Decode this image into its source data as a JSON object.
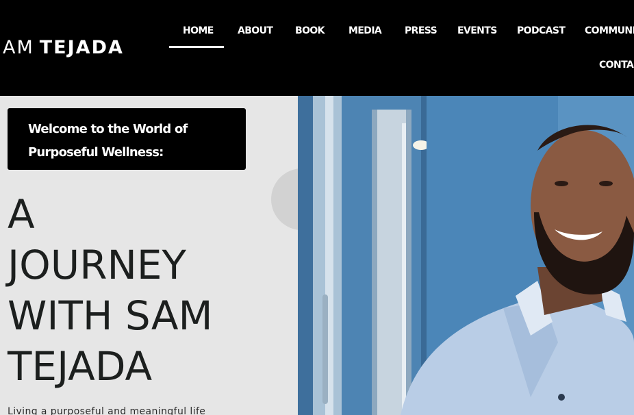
{
  "site": {
    "logo_first": "AM",
    "logo_last": "TEJADA"
  },
  "nav": {
    "items": [
      {
        "label": "HOME",
        "active": true
      },
      {
        "label": "ABOUT"
      },
      {
        "label": "BOOK"
      },
      {
        "label": "MEDIA"
      },
      {
        "label": "PRESS"
      },
      {
        "label": "EVENTS"
      },
      {
        "label": "PODCAST"
      },
      {
        "label": "COMMUNIT"
      },
      {
        "label": "CONTAC"
      }
    ]
  },
  "hero": {
    "welcome_line1": "Welcome to the World of",
    "welcome_line2": "Purposeful Wellness:",
    "headline": [
      "A",
      "JOURNEY",
      "WITH SAM",
      "TEJADA"
    ],
    "intro": "Living a purposeful and meaningful life",
    "photo_icon": "portrait-photo"
  },
  "colors": {
    "header_bg": "#000000",
    "panel_bg": "#e6e6e6",
    "headline": "#1c1f1e",
    "photo_wall": "#4a80ad"
  }
}
